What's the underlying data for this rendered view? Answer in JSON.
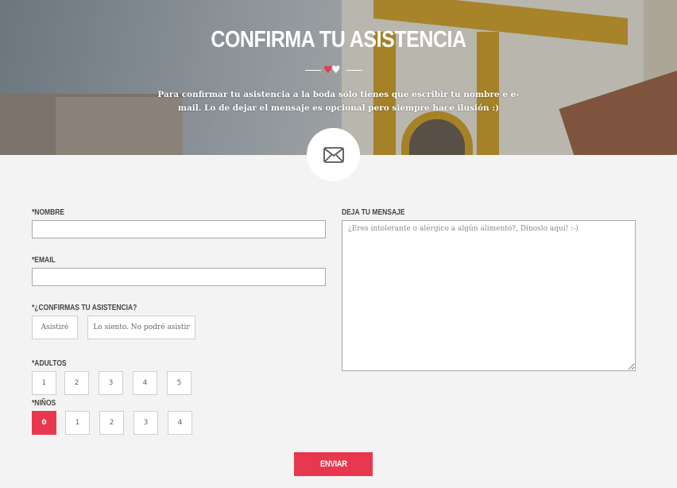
{
  "header": {
    "title": "CONFIRMA TU ASISTENCIA",
    "subtitle": "Para confirmar tu asistencia a la boda sólo tienes que escribir tu nombre e e-mail. Lo de dejar el mensaje es opcional pero siempre hace ilusión :)",
    "accent_color": "#e8384f",
    "icons": [
      "heart-icon",
      "heart-icon",
      "envelope-icon"
    ],
    "heart_glyph": "♥"
  },
  "form": {
    "name_label": "*NOMBRE",
    "name_value": "",
    "email_label": "*EMAIL",
    "email_value": "",
    "confirm_label": "*¿CONFIRMAS TU ASISTENCIA?",
    "confirm_options": [
      "Asistiré",
      "Lo siento. No podré asistir"
    ],
    "adults_label": "*ADULTOS",
    "adults_options": [
      "1",
      "2",
      "3",
      "4",
      "5"
    ],
    "children_label": "*NIÑOS",
    "children_options": [
      "0",
      "1",
      "2",
      "3",
      "4"
    ],
    "children_selected": "0",
    "message_label": "DEJA TU MENSAJE",
    "message_placeholder": "¿Eres intolerante o alérgico a algún alimento?, Dínoslo aquí! :-)",
    "submit_label": "ENVIAR"
  }
}
